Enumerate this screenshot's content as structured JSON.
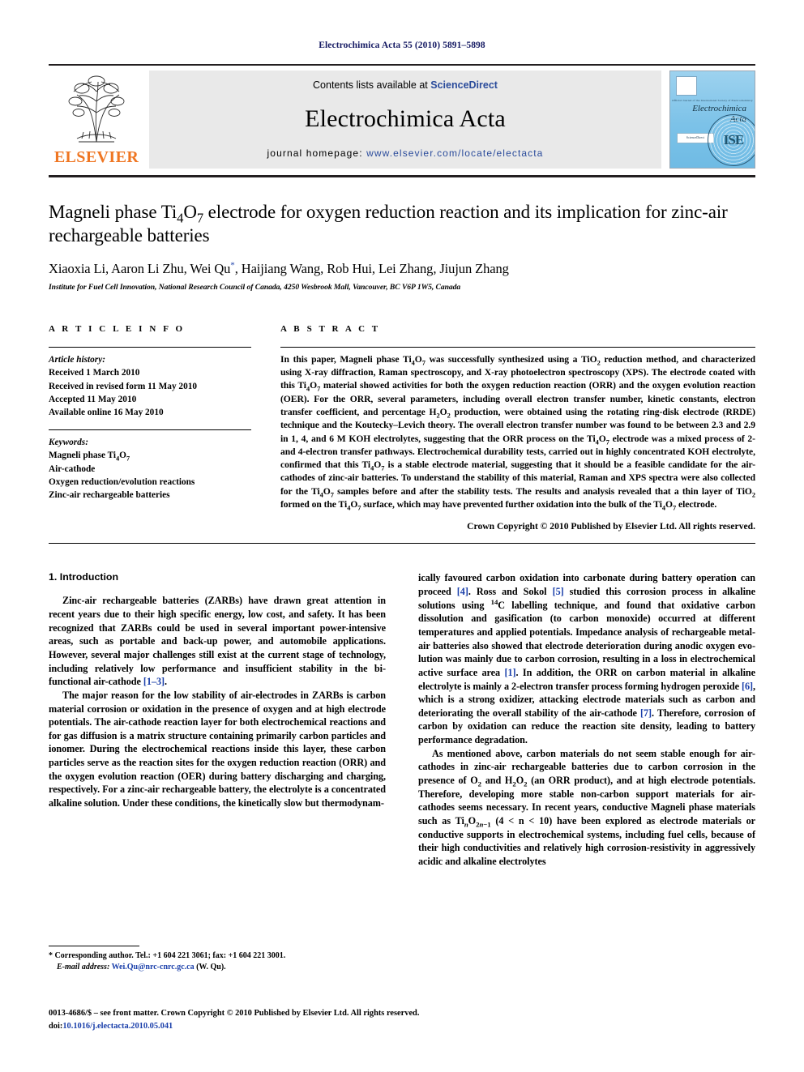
{
  "running_head": "Electrochimica Acta 55 (2010) 5891–5898",
  "masthead": {
    "contents_prefix": "Contents lists available at",
    "sciencedirect": "ScienceDirect",
    "journal_title": "Electrochimica Acta",
    "homepage_prefix": "journal homepage:",
    "homepage_url": "www.elsevier.com/locate/electacta",
    "publisher_logo_word": "ELSEVIER",
    "publisher_logo_icon": "elsevier-tree-icon",
    "cover": {
      "society_line": "Official Journal of the International Society of Electrochemistry",
      "title_line1": "Electrochimica",
      "title_line2": "Acta",
      "sciencedirect_badge": "ScienceDirect",
      "society_emblem": "ISE"
    }
  },
  "article": {
    "title": "Magneli phase Ti4O7 electrode for oxygen reduction reaction and its implication for zinc-air rechargeable batteries",
    "authors": "Xiaoxia Li, Aaron Li Zhu, Wei Qu*, Haijiang Wang, Rob Hui, Lei Zhang, Jiujun Zhang",
    "affiliation": "Institute for Fuel Cell Innovation, National Research Council of Canada, 4250 Wesbrook Mall, Vancouver, BC V6P 1W5, Canada"
  },
  "article_info": {
    "heading": "A R T I C L E    I N F O",
    "history_label": "Article history:",
    "history": [
      "Received 1 March 2010",
      "Received in revised form 11 May 2010",
      "Accepted 11 May 2010",
      "Available online 16 May 2010"
    ],
    "keywords_label": "Keywords:",
    "keywords": [
      "Magneli phase Ti4O7",
      "Air-cathode",
      "Oxygen reduction/evolution reactions",
      "Zinc-air rechargeable batteries"
    ]
  },
  "abstract": {
    "heading": "A B S T R A C T",
    "text": "In this paper, Magneli phase Ti4O7 was successfully synthesized using a TiO2 reduction method, and characterized using X-ray diffraction, Raman spectroscopy, and X-ray photoelectron spectroscopy (XPS). The electrode coated with this Ti4O7 material showed activities for both the oxygen reduction reaction (ORR) and the oxygen evolution reaction (OER). For the ORR, several parameters, including overall electron transfer number, kinetic constants, electron transfer coefficient, and percentage H2O2 production, were obtained using the rotating ring-disk electrode (RRDE) technique and the Koutecky–Levich theory. The overall electron transfer number was found to be between 2.3 and 2.9 in 1, 4, and 6 M KOH electrolytes, suggesting that the ORR process on the Ti4O7 electrode was a mixed process of 2- and 4-electron transfer pathways. Electrochemical durability tests, carried out in highly concentrated KOH electrolyte, confirmed that this Ti4O7 is a stable electrode material, suggesting that it should be a feasible candidate for the air-cathodes of zinc-air batteries. To understand the stability of this material, Raman and XPS spectra were also collected for the Ti4O7 samples before and after the stability tests. The results and analysis revealed that a thin layer of TiO2 formed on the Ti4O7 surface, which may have prevented further oxidation into the bulk of the Ti4O7 electrode.",
    "copyright": "Crown Copyright © 2010 Published by Elsevier Ltd. All rights reserved."
  },
  "body": {
    "section_number_title": "1.  Introduction",
    "left_paragraphs": [
      "Zinc-air rechargeable batteries (ZARBs) have drawn great attention in recent years due to their high specific energy, low cost, and safety. It has been recognized that ZARBs could be used in several important power-intensive areas, such as portable and back-up power, and automobile applications. However, several major challenges still exist at the current stage of technology, including relatively low performance and insufficient stability in the bi-functional air-cathode [1–3].",
      "The major reason for the low stability of air-electrodes in ZARBs is carbon material corrosion or oxidation in the presence of oxygen and at high electrode potentials. The air-cathode reaction layer for both electrochemical reactions and for gas diffusion is a matrix structure containing primarily carbon particles and ionomer. During the electrochemical reactions inside this layer, these carbon particles serve as the reaction sites for the oxygen reduction reaction (ORR) and the oxygen evolution reaction (OER) during battery discharging and charging, respectively. For a zinc-air rechargeable battery, the electrolyte is a concentrated alkaline solution. Under these conditions, the kinetically slow but thermodynam-"
    ],
    "right_paragraphs": [
      "ically favoured carbon oxidation into carbonate during battery operation can proceed [4]. Ross and Sokol [5] studied this corrosion process in alkaline solutions using 14C labelling technique, and found that oxidative carbon dissolution and gasification (to carbon monoxide) occurred at different temperatures and applied potentials. Impedance analysis of rechargeable metal-air batteries also showed that electrode deterioration during anodic oxygen evolution was mainly due to carbon corrosion, resulting in a loss in electrochemical active surface area [1]. In addition, the ORR on carbon material in alkaline electrolyte is mainly a 2-electron transfer process forming hydrogen peroxide [6], which is a strong oxidizer, attacking electrode materials such as carbon and deteriorating the overall stability of the air-cathode [7]. Therefore, corrosion of carbon by oxidation can reduce the reaction site density, leading to battery performance degradation.",
      "As mentioned above, carbon materials do not seem stable enough for air-cathodes in zinc-air rechargeable batteries due to carbon corrosion in the presence of O2 and H2O2 (an ORR product), and at high electrode potentials. Therefore, developing more stable non-carbon support materials for air-cathodes seems necessary. In recent years, conductive Magneli phase materials such as TinO2n−1 (4 < n < 10) have been explored as electrode materials or conductive supports in electrochemical systems, including fuel cells, because of their high conductivities and relatively high corrosion-resistivity in aggressively acidic and alkaline electrolytes"
    ]
  },
  "footnote": {
    "corresponding": "* Corresponding author. Tel.: +1 604 221 3061; fax: +1 604 221 3001.",
    "email_label": "E-mail address:",
    "email": "Wei.Qu@nrc-cnrc.gc.ca",
    "email_suffix": "(W. Qu)."
  },
  "page_footer": {
    "issn_line": "0013-4686/$ – see front matter. Crown Copyright © 2010 Published by Elsevier Ltd. All rights reserved.",
    "doi_label": "doi:",
    "doi_value": "10.1016/j.electacta.2010.05.041"
  },
  "colors": {
    "link_blue": "#1a3faa",
    "running_head_blue": "#151a63",
    "elsevier_orange": "#ef7622",
    "band_gray": "#e9e9e9",
    "cover_blue": "#7cc2e8"
  }
}
